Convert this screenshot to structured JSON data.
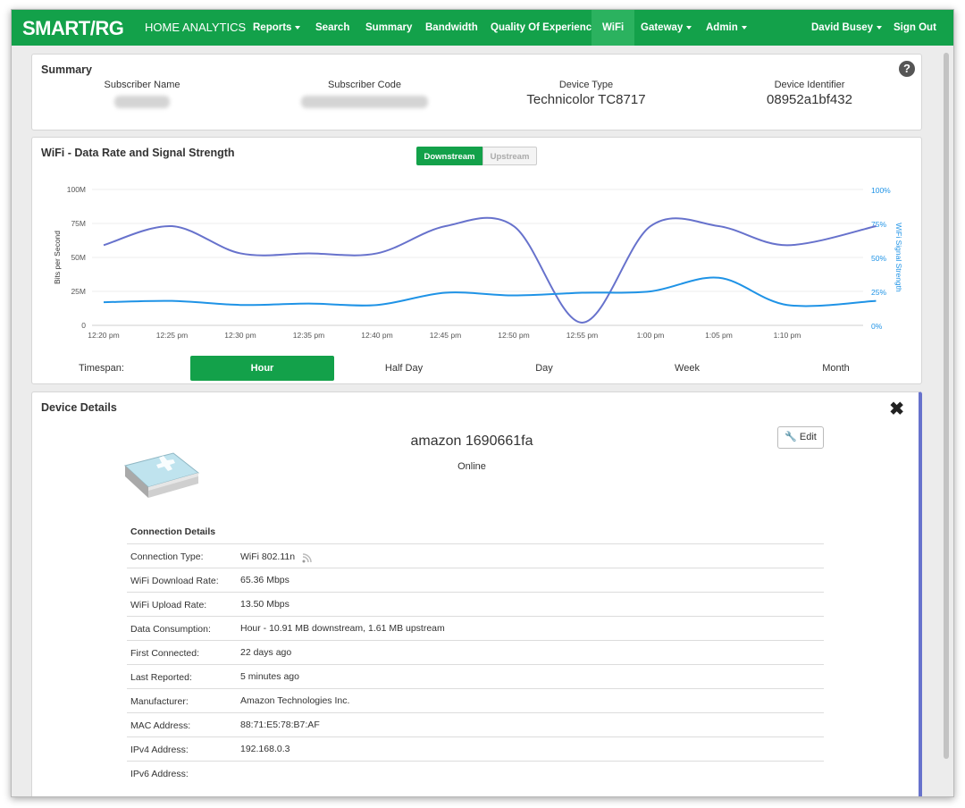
{
  "navbar": {
    "brand": "SMART/RG",
    "home": "HOME ANALYTICS",
    "items": [
      "Reports",
      "Search",
      "Summary",
      "Bandwidth",
      "Quality Of Experience",
      "WiFi",
      "Gateway",
      "Admin"
    ],
    "user": "David Busey",
    "signout": "Sign Out",
    "active": "WiFi",
    "color": "#13a14a"
  },
  "summary": {
    "title": "Summary",
    "subscriber_name_label": "Subscriber Name",
    "subscriber_code_label": "Subscriber Code",
    "device_type_label": "Device Type",
    "device_type": "Technicolor TC8717",
    "device_identifier_label": "Device Identifier",
    "device_identifier": "08952a1bf432",
    "help_icon": "?"
  },
  "wifi_chart": {
    "title": "WiFi - Data Rate and Signal Strength",
    "toggle": [
      "Downstream",
      "Upstream"
    ],
    "timespan_label": "Timespan:",
    "timespans": [
      "Hour",
      "Half Day",
      "Day",
      "Week",
      "Month"
    ],
    "selected_timespan": "Hour"
  },
  "chart_data": {
    "type": "line",
    "x": [
      "12:20 pm",
      "12:25 pm",
      "12:30 pm",
      "12:35 pm",
      "12:40 pm",
      "12:45 pm",
      "12:50 pm",
      "12:55 pm",
      "1:00 pm",
      "1:05 pm",
      "1:10 pm"
    ],
    "ylabel": "Bits per Second",
    "y_ticks": [
      "0",
      "25M",
      "50M",
      "75M",
      "100M"
    ],
    "ylim": [
      0,
      100000000
    ],
    "y2label": "WiFi Signal Strength",
    "y2_ticks": [
      "0%",
      "25%",
      "50%",
      "75%",
      "100%"
    ],
    "y2lim": [
      0,
      100
    ],
    "grid": "horizontal",
    "series": [
      {
        "axis": "left",
        "color": "#6772cc",
        "points": [
          [
            0,
            59000000
          ],
          [
            1,
            73000000
          ],
          [
            2,
            53000000
          ],
          [
            3,
            53000000
          ],
          [
            4,
            53000000
          ],
          [
            5,
            73000000
          ],
          [
            6,
            73000000
          ],
          [
            7,
            2000000
          ],
          [
            8,
            73000000
          ],
          [
            9,
            73000000
          ],
          [
            10,
            59000000
          ],
          [
            11.3,
            73000000
          ]
        ]
      },
      {
        "axis": "right",
        "color": "#1f93e6",
        "points": [
          [
            0,
            17
          ],
          [
            1,
            18
          ],
          [
            2,
            15
          ],
          [
            3,
            16
          ],
          [
            4,
            15
          ],
          [
            5,
            24
          ],
          [
            6,
            22
          ],
          [
            7,
            24
          ],
          [
            8,
            25
          ],
          [
            9,
            35
          ],
          [
            10,
            15
          ],
          [
            11.3,
            18
          ]
        ]
      }
    ]
  },
  "device_details": {
    "title": "Device Details",
    "close_icon": "✖",
    "edit_label": "Edit",
    "device_name": "amazon 1690661fa",
    "status": "Online",
    "section_title": "Connection Details",
    "rows": [
      {
        "label": "Connection Type:",
        "value": "WiFi 802.11n"
      },
      {
        "label": "WiFi Download Rate:",
        "value": "65.36 Mbps"
      },
      {
        "label": "WiFi Upload Rate:",
        "value": "13.50 Mbps"
      },
      {
        "label": "Data Consumption:",
        "value": "Hour - 10.91 MB downstream, 1.61 MB upstream"
      },
      {
        "label": "First Connected:",
        "value": "22 days ago"
      },
      {
        "label": "Last Reported:",
        "value": "5 minutes ago"
      },
      {
        "label": "Manufacturer:",
        "value": "Amazon Technologies Inc."
      },
      {
        "label": "MAC Address:",
        "value": "88:71:E5:78:B7:AF"
      },
      {
        "label": "IPv4 Address:",
        "value": "192.168.0.3"
      },
      {
        "label": "IPv6 Address:",
        "value": ""
      }
    ]
  }
}
